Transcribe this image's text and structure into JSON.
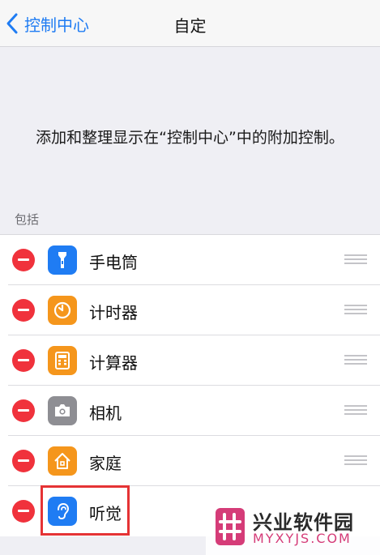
{
  "navbar": {
    "back_label": "控制中心",
    "title": "自定"
  },
  "description": "添加和整理显示在“控制中心”中的附加控制。",
  "section_header": "包括",
  "items": [
    {
      "label": "手电筒",
      "icon": "flashlight-icon",
      "color": "#1f7cf3"
    },
    {
      "label": "计时器",
      "icon": "timer-icon",
      "color": "#f5961c"
    },
    {
      "label": "计算器",
      "icon": "calculator-icon",
      "color": "#f5961c"
    },
    {
      "label": "相机",
      "icon": "camera-icon",
      "color": "#8e8e93"
    },
    {
      "label": "家庭",
      "icon": "home-icon",
      "color": "#f5961c"
    },
    {
      "label": "听觉",
      "icon": "ear-icon",
      "color": "#1f7cf3"
    }
  ],
  "colors": {
    "accent": "#1f7cf3",
    "remove": "#f0323c",
    "highlight": "#e53335"
  },
  "watermark": {
    "title": "兴业软件园",
    "subtitle": "MYXYJS.COM"
  }
}
